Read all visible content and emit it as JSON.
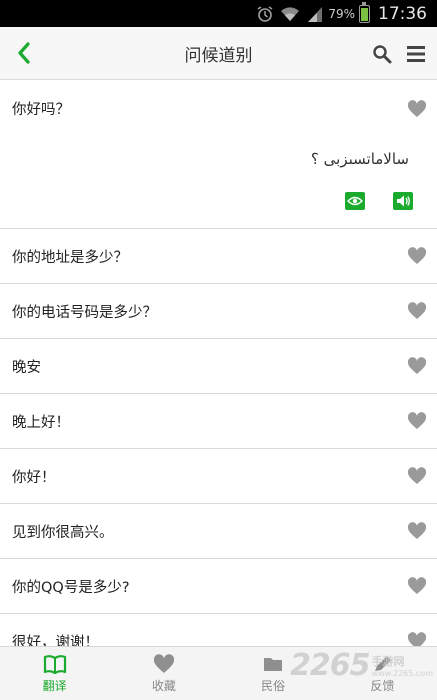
{
  "status_bar": {
    "battery": "79%",
    "time": "17:36",
    "icons": [
      "alarm-icon",
      "wifi-icon",
      "signal-icon",
      "battery-icon"
    ]
  },
  "header": {
    "title": "问候道别",
    "back_icon": "chevron-left-icon",
    "search_icon": "search-icon",
    "menu_icon": "menu-icon"
  },
  "list": {
    "items": [
      {
        "text": "你好吗？",
        "translation": "سالاماتسىزبى ؟",
        "expanded": true
      },
      {
        "text": "你的地址是多少？"
      },
      {
        "text": "你的电话号码是多少？"
      },
      {
        "text": "晚安"
      },
      {
        "text": "晚上好！"
      },
      {
        "text": "你好！"
      },
      {
        "text": "见到你很高兴。"
      },
      {
        "text": "你的QQ号是多少?"
      },
      {
        "text": "很好，谢谢！"
      }
    ]
  },
  "tabs": [
    {
      "label": "翻译",
      "icon": "book-icon",
      "active": true
    },
    {
      "label": "收藏",
      "icon": "heart-icon",
      "active": false
    },
    {
      "label": "民俗",
      "icon": "folder-icon",
      "active": false
    },
    {
      "label": "反馈",
      "icon": "pen-icon",
      "active": false
    }
  ],
  "watermark": {
    "number": "2265",
    "cn": "手游网",
    "url": "www.2265.com"
  },
  "colors": {
    "accent": "#1aaa2e",
    "icon_gray": "#9a9a9a",
    "header_bg": "#f7f7f7",
    "statusbar_bg": "#000000"
  }
}
